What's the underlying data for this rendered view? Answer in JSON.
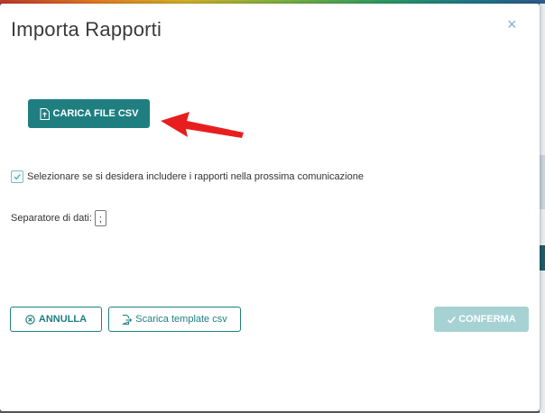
{
  "dialog": {
    "title": "Importa Rapporti",
    "close_glyph": "×"
  },
  "upload_button": {
    "label": "CARICA FILE CSV",
    "icon": "file-upload-icon"
  },
  "annotation": {
    "arrow_color": "#e81e1e"
  },
  "include_checkbox": {
    "checked": true,
    "label": "Selezionare se si desidera includere i rapporti nella prossima comunicazione"
  },
  "separator": {
    "label": "Separatore di dati:",
    "value": ";"
  },
  "footer": {
    "cancel_label": "ANNULLA",
    "cancel_icon": "times-circle-icon",
    "template_label": "Scarica template csv",
    "template_icon": "file-export-icon",
    "confirm_label": "CONFERMA",
    "confirm_icon": "check-icon"
  },
  "colors": {
    "accent": "#1f7f80",
    "confirm_disabled": "#a6d2d3",
    "checkbox_border": "#7fbcc4"
  }
}
